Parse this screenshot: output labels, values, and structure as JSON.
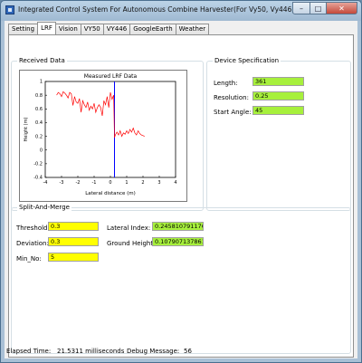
{
  "window": {
    "title": "Integrated Control System For Autonomous Combine Harvester(For Vy50, Vy446)"
  },
  "tabs": [
    "Setting",
    "LRF",
    "Vision",
    "VY50",
    "VY446",
    "GoogleEarth",
    "Weather"
  ],
  "active_tab": "LRF",
  "received": {
    "group_label": "Received Data"
  },
  "device": {
    "group_label": "Device Specification",
    "length_label": "Length:",
    "length": "361",
    "resolution_label": "Resolution:",
    "resolution": "0.25",
    "start_angle_label": "Start Angle:",
    "start_angle": "45"
  },
  "split": {
    "group_label": "Split-And-Merge",
    "threshold_label": "Threshold:",
    "threshold": "0.3",
    "deviation_label": "Deviation:",
    "deviation": "0.3",
    "min_no_label": "Min_No:",
    "min_no": "5",
    "lateral_index_label": "Lateral Index:",
    "lateral_index": "0.245810791176231",
    "ground_height_label": "Ground Height:",
    "ground_height": "0.107907137861211"
  },
  "status": {
    "elapsed_label": "Elapsed Time:",
    "elapsed_value": "21.5311 milliseconds",
    "debug_label": "Debug Message:",
    "debug_value": "56"
  },
  "colors": {
    "series": "#ff0000",
    "marker_line": "#0000ff",
    "green_field": "#a7f03c",
    "yellow_field": "#ffff00"
  },
  "chart_data": {
    "type": "line",
    "title": "Measured LRF Data",
    "xlabel": "Lateral distance (m)",
    "ylabel": "Height (m)",
    "xlim": [
      -4,
      4
    ],
    "ylim": [
      -0.4,
      1.0
    ],
    "xticks": [
      "-4",
      "-3",
      "-2",
      "-1",
      "0",
      "1",
      "2",
      "3",
      "4"
    ],
    "yticks": [
      "1",
      "0.8",
      "0.6",
      "0.4",
      "0.2",
      "0",
      "-0.2",
      "-0.4"
    ],
    "grid": false,
    "vline_x": 0.25,
    "series": [
      {
        "x": [
          -3.3,
          -3.2,
          -3.1,
          -3.0,
          -2.9,
          -2.8,
          -2.7,
          -2.6,
          -2.5,
          -2.4,
          -2.3,
          -2.2,
          -2.1,
          -2.0,
          -1.9,
          -1.8,
          -1.7,
          -1.6,
          -1.5,
          -1.4,
          -1.3,
          -1.2,
          -1.1,
          -1.0,
          -0.9,
          -0.8,
          -0.7,
          -0.6,
          -0.5,
          -0.4,
          -0.3,
          -0.2,
          -0.1,
          0.0,
          0.1,
          0.2,
          0.25,
          0.3,
          0.4,
          0.5,
          0.6,
          0.7,
          0.8,
          0.9,
          1.0,
          1.1,
          1.2,
          1.3,
          1.4,
          1.5,
          1.6,
          1.7,
          1.8,
          1.9,
          2.0,
          2.1
        ],
        "y": [
          0.8,
          0.84,
          0.82,
          0.78,
          0.85,
          0.83,
          0.8,
          0.76,
          0.84,
          0.82,
          0.65,
          0.78,
          0.7,
          0.68,
          0.75,
          0.55,
          0.72,
          0.66,
          0.62,
          0.7,
          0.58,
          0.64,
          0.6,
          0.68,
          0.55,
          0.62,
          0.66,
          0.62,
          0.5,
          0.72,
          0.66,
          0.78,
          0.62,
          0.84,
          0.74,
          0.8,
          0.18,
          0.22,
          0.26,
          0.22,
          0.28,
          0.2,
          0.25,
          0.23,
          0.28,
          0.24,
          0.3,
          0.26,
          0.32,
          0.25,
          0.22,
          0.28,
          0.24,
          0.22,
          0.21,
          0.2
        ]
      }
    ]
  }
}
